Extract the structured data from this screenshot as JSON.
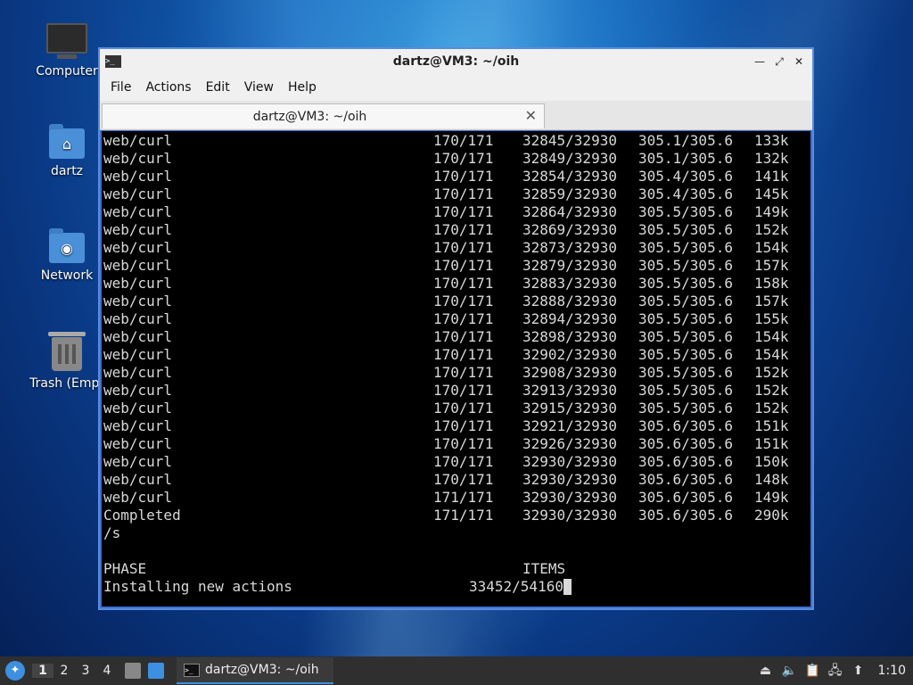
{
  "desktop": {
    "icons": [
      {
        "label": "Computer"
      },
      {
        "label": "dartz"
      },
      {
        "label": "Network"
      },
      {
        "label": "Trash (Empt"
      }
    ]
  },
  "window": {
    "title": "dartz@VM3: ~/oih",
    "menu": [
      "File",
      "Actions",
      "Edit",
      "View",
      "Help"
    ],
    "tab_title": "dartz@VM3: ~/oih"
  },
  "terminal": {
    "rows": [
      {
        "name": "web/curl",
        "pkgs": "170/171",
        "files": "32845/32930",
        "size": "305.1/305.6",
        "rate": "133k"
      },
      {
        "name": "web/curl",
        "pkgs": "170/171",
        "files": "32849/32930",
        "size": "305.1/305.6",
        "rate": "132k"
      },
      {
        "name": "web/curl",
        "pkgs": "170/171",
        "files": "32854/32930",
        "size": "305.4/305.6",
        "rate": "141k"
      },
      {
        "name": "web/curl",
        "pkgs": "170/171",
        "files": "32859/32930",
        "size": "305.4/305.6",
        "rate": "145k"
      },
      {
        "name": "web/curl",
        "pkgs": "170/171",
        "files": "32864/32930",
        "size": "305.5/305.6",
        "rate": "149k"
      },
      {
        "name": "web/curl",
        "pkgs": "170/171",
        "files": "32869/32930",
        "size": "305.5/305.6",
        "rate": "152k"
      },
      {
        "name": "web/curl",
        "pkgs": "170/171",
        "files": "32873/32930",
        "size": "305.5/305.6",
        "rate": "154k"
      },
      {
        "name": "web/curl",
        "pkgs": "170/171",
        "files": "32879/32930",
        "size": "305.5/305.6",
        "rate": "157k"
      },
      {
        "name": "web/curl",
        "pkgs": "170/171",
        "files": "32883/32930",
        "size": "305.5/305.6",
        "rate": "158k"
      },
      {
        "name": "web/curl",
        "pkgs": "170/171",
        "files": "32888/32930",
        "size": "305.5/305.6",
        "rate": "157k"
      },
      {
        "name": "web/curl",
        "pkgs": "170/171",
        "files": "32894/32930",
        "size": "305.5/305.6",
        "rate": "155k"
      },
      {
        "name": "web/curl",
        "pkgs": "170/171",
        "files": "32898/32930",
        "size": "305.5/305.6",
        "rate": "154k"
      },
      {
        "name": "web/curl",
        "pkgs": "170/171",
        "files": "32902/32930",
        "size": "305.5/305.6",
        "rate": "154k"
      },
      {
        "name": "web/curl",
        "pkgs": "170/171",
        "files": "32908/32930",
        "size": "305.5/305.6",
        "rate": "152k"
      },
      {
        "name": "web/curl",
        "pkgs": "170/171",
        "files": "32913/32930",
        "size": "305.5/305.6",
        "rate": "152k"
      },
      {
        "name": "web/curl",
        "pkgs": "170/171",
        "files": "32915/32930",
        "size": "305.5/305.6",
        "rate": "152k"
      },
      {
        "name": "web/curl",
        "pkgs": "170/171",
        "files": "32921/32930",
        "size": "305.6/305.6",
        "rate": "151k"
      },
      {
        "name": "web/curl",
        "pkgs": "170/171",
        "files": "32926/32930",
        "size": "305.6/305.6",
        "rate": "151k"
      },
      {
        "name": "web/curl",
        "pkgs": "170/171",
        "files": "32930/32930",
        "size": "305.6/305.6",
        "rate": "150k"
      },
      {
        "name": "web/curl",
        "pkgs": "170/171",
        "files": "32930/32930",
        "size": "305.6/305.6",
        "rate": "148k"
      },
      {
        "name": "web/curl",
        "pkgs": "171/171",
        "files": "32930/32930",
        "size": "305.6/305.6",
        "rate": "149k"
      },
      {
        "name": "Completed",
        "pkgs": "171/171",
        "files": "32930/32930",
        "size": "305.6/305.6",
        "rate": "290k"
      }
    ],
    "trailing_line": "/s",
    "phase_header": "PHASE",
    "items_header": "ITEMS",
    "phase_label": "Installing new actions",
    "phase_items": "33452/54160"
  },
  "taskbar": {
    "workspaces": [
      "1",
      "2",
      "3",
      "4"
    ],
    "task_title": "dartz@VM3: ~/oih",
    "clock": "1:10"
  }
}
